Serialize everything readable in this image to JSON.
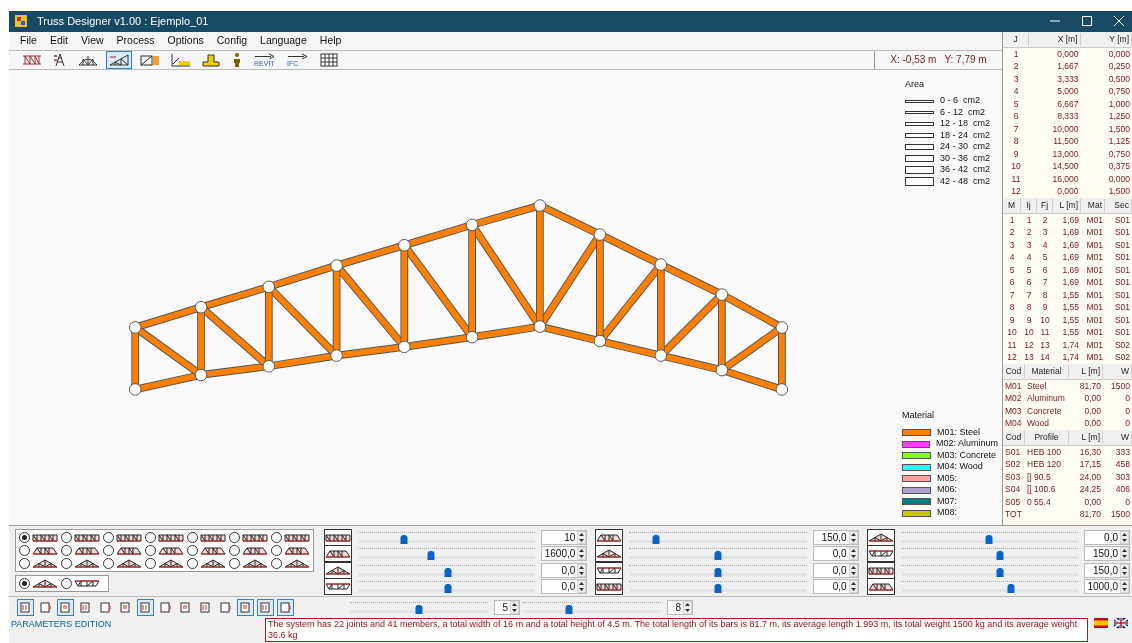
{
  "window": {
    "title": "Truss Designer v1.00 : Ejemplo_01"
  },
  "menu": [
    "File",
    "Edit",
    "View",
    "Process",
    "Options",
    "Config",
    "Language",
    "Help"
  ],
  "toolbar": [
    {
      "kind": "grid",
      "selected": false
    },
    {
      "kind": "tower",
      "selected": false
    },
    {
      "kind": "bridge",
      "selected": false
    },
    {
      "kind": "truss",
      "selected": true
    },
    {
      "kind": "section",
      "selected": false
    },
    {
      "kind": "chart",
      "selected": false
    },
    {
      "kind": "profile",
      "selected": false
    },
    {
      "kind": "person",
      "selected": false
    },
    {
      "kind": "export",
      "label": "REVIT",
      "selected": false
    },
    {
      "kind": "export",
      "label": "IFC",
      "selected": false
    },
    {
      "kind": "table",
      "selected": false
    }
  ],
  "coordinates": {
    "x": "X: -0,53 m",
    "y": "Y: 7,79 m"
  },
  "area_legend": {
    "title": "Area",
    "items": [
      "0 - 6  cm2",
      "6 - 12  cm2",
      "12 - 18  cm2",
      "18 - 24  cm2",
      "24 - 30  cm2",
      "30 - 36  cm2",
      "36 - 42  cm2",
      "42 - 48  cm2"
    ]
  },
  "material_legend": {
    "title": "Material",
    "items": [
      {
        "label": "M01: Steel",
        "color": "#ff8000"
      },
      {
        "label": "M02: Aluminum",
        "color": "#ff40ff"
      },
      {
        "label": "M03: Concrete",
        "color": "#80ff20"
      },
      {
        "label": "M04: Wood",
        "color": "#20ffff"
      },
      {
        "label": "M05:",
        "color": "#ffa0a0"
      },
      {
        "label": "M06:",
        "color": "#b0a0d0"
      },
      {
        "label": "M07:",
        "color": "#008080"
      },
      {
        "label": "M08:",
        "color": "#c8c800"
      }
    ]
  },
  "joints_table": {
    "columns": [
      "J",
      "X [m]",
      "Y [m]"
    ],
    "rows": [
      [
        "1",
        "0,000",
        "0,000"
      ],
      [
        "2",
        "1,667",
        "0,250"
      ],
      [
        "3",
        "3,333",
        "0,500"
      ],
      [
        "4",
        "5,000",
        "0,750"
      ],
      [
        "5",
        "6,667",
        "1,000"
      ],
      [
        "6",
        "8,333",
        "1,250"
      ],
      [
        "7",
        "10,000",
        "1,500"
      ],
      [
        "8",
        "11,500",
        "1,125"
      ],
      [
        "9",
        "13,000",
        "0,750"
      ],
      [
        "10",
        "14,500",
        "0,375"
      ],
      [
        "11",
        "16,000",
        "0,000"
      ],
      [
        "12",
        "0,000",
        "1,500"
      ]
    ]
  },
  "members_table": {
    "columns": [
      "M",
      "Ij",
      "Fj",
      "L [m]",
      "Mat",
      "Sec"
    ],
    "rows": [
      [
        "1",
        "1",
        "2",
        "1,69",
        "M01",
        "S01"
      ],
      [
        "2",
        "2",
        "3",
        "1,69",
        "M01",
        "S01"
      ],
      [
        "3",
        "3",
        "4",
        "1,69",
        "M01",
        "S01"
      ],
      [
        "4",
        "4",
        "5",
        "1,69",
        "M01",
        "S01"
      ],
      [
        "5",
        "5",
        "6",
        "1,69",
        "M01",
        "S01"
      ],
      [
        "6",
        "6",
        "7",
        "1,69",
        "M01",
        "S01"
      ],
      [
        "7",
        "7",
        "8",
        "1,55",
        "M01",
        "S01"
      ],
      [
        "8",
        "8",
        "9",
        "1,55",
        "M01",
        "S01"
      ],
      [
        "9",
        "9",
        "10",
        "1,55",
        "M01",
        "S01"
      ],
      [
        "10",
        "10",
        "11",
        "1,55",
        "M01",
        "S01"
      ],
      [
        "11",
        "12",
        "13",
        "1,74",
        "M01",
        "S02"
      ],
      [
        "12",
        "13",
        "14",
        "1,74",
        "M01",
        "S02"
      ]
    ]
  },
  "materials_table": {
    "columns": [
      "Cod",
      "Material",
      "L [m]",
      "W"
    ],
    "rows": [
      [
        "M01",
        "Steel",
        "81,70",
        "1500"
      ],
      [
        "M02",
        "Aluminum",
        "0,00",
        "0"
      ],
      [
        "M03",
        "Concrete",
        "0,00",
        "0"
      ],
      [
        "M04",
        "Wood",
        "0,00",
        "0"
      ]
    ]
  },
  "profiles_table": {
    "columns": [
      "Cod",
      "Profile",
      "L [m]",
      "W"
    ],
    "rows": [
      [
        "S01",
        "HEB 100",
        "16,30",
        "333"
      ],
      [
        "S02",
        "HEB 120",
        "17,15",
        "458"
      ],
      [
        "S03",
        "[] 90.5",
        "24,00",
        "303"
      ],
      [
        "S04",
        "[] 100.6",
        "24,25",
        "406"
      ],
      [
        "S05",
        "0 55.4",
        "0,00",
        "0"
      ]
    ],
    "total": {
      "label": "TOT",
      "length": "81,70",
      "weight": "1500"
    }
  },
  "truss_types": [
    [
      {
        "selected": true
      },
      {
        "selected": false
      },
      {
        "selected": false
      },
      {
        "selected": false
      },
      {
        "selected": false
      },
      {
        "selected": false
      },
      {
        "selected": false
      }
    ],
    [
      {
        "selected": false
      },
      {
        "selected": false
      },
      {
        "selected": false
      },
      {
        "selected": false
      },
      {
        "selected": false
      },
      {
        "selected": false
      },
      {
        "selected": false
      }
    ],
    [
      {
        "selected": false
      },
      {
        "selected": false
      },
      {
        "selected": false
      },
      {
        "selected": false
      },
      {
        "selected": false
      },
      {
        "selected": false
      },
      {
        "selected": false
      }
    ]
  ],
  "support_types": [
    {
      "selected": true
    },
    {
      "selected": false
    }
  ],
  "parameters": [
    [
      {
        "value": "10",
        "level": 0.26
      },
      {
        "value": "1600,0",
        "level": 0.41
      },
      {
        "value": "0,0",
        "level": 0.51
      },
      {
        "value": "0,0",
        "level": 0.51
      }
    ],
    [
      {
        "value": "150,0",
        "level": 0.15
      },
      {
        "value": "0,0",
        "level": 0.5
      },
      {
        "value": "0,0",
        "level": 0.5
      },
      {
        "value": "0,0",
        "level": 0.5
      }
    ],
    [
      {
        "value": "0,0",
        "level": 0.5
      },
      {
        "value": "150,0",
        "level": 0.56
      },
      {
        "value": "150,0",
        "level": 0.56
      },
      {
        "value": "1000,0",
        "level": 0.62
      }
    ]
  ],
  "bottom_toolbar": [
    {
      "selected": true
    },
    {
      "selected": false
    },
    {
      "selected": true
    },
    {
      "selected": false
    },
    {
      "selected": false
    },
    {
      "selected": false
    },
    {
      "selected": true
    },
    {
      "selected": false
    },
    {
      "selected": false
    },
    {
      "selected": false
    },
    {
      "selected": false
    },
    {
      "selected": true
    },
    {
      "selected": true
    },
    {
      "selected": true
    }
  ],
  "view_sliders": [
    {
      "value": "5",
      "level": 0.5
    },
    {
      "value": "8",
      "level": 0.33
    }
  ],
  "status_bar": {
    "mode": "PARAMETERS EDITION",
    "message": "The system has 22 joints and 41 members, a total width of 16 m and a total height of 4.5 m. The total length of its bars is 81.7 m, its average length 1.993 m, its total weight 1500 kg and its average weight 36.6 kg"
  }
}
